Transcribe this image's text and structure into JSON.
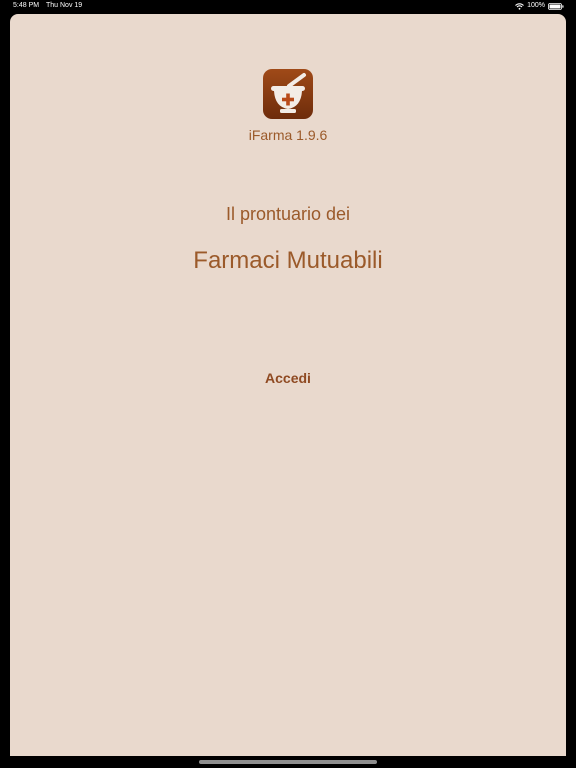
{
  "status_bar": {
    "time": "5:48 PM",
    "date": "Thu Nov 19",
    "battery": "100%"
  },
  "app": {
    "icon": "mortar-pestle-cross-icon",
    "version_label": "iFarma 1.9.6"
  },
  "main": {
    "subtitle": "Il prontuario dei",
    "title": "Farmaci Mutuabili",
    "login_label": "Accedi"
  },
  "colors": {
    "background": "#e9d9cd",
    "accent": "#9b5a2a",
    "icon_bg": "#8b3d12"
  }
}
